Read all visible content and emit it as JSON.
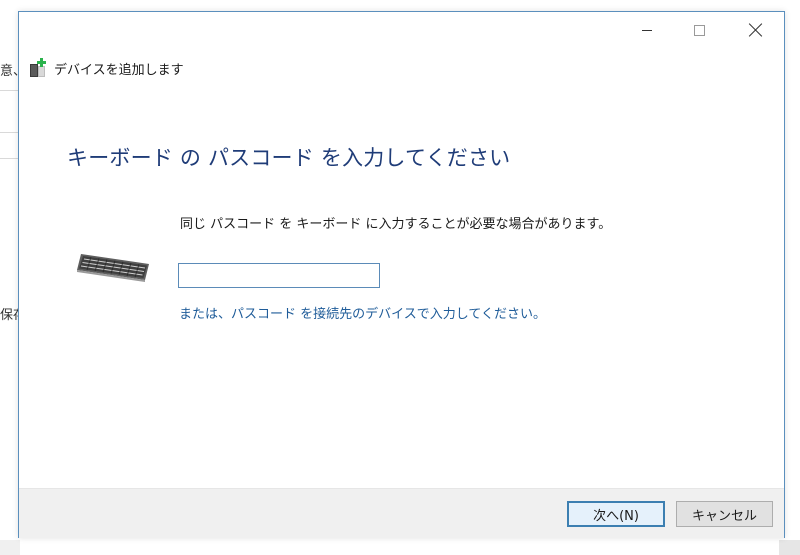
{
  "background_window": {
    "text_top": "意、/",
    "text_mid": "保存"
  },
  "dialog": {
    "title": "デバイスを追加します",
    "heading": "キーボード の パスコード を入力してください",
    "instruction": "同じ パスコード を キーボード に入力することが必要な場合があります。",
    "passcode_value": "",
    "alt_link": "または、パスコード を接続先のデバイスで入力してください。",
    "buttons": {
      "next": "次へ(N)",
      "cancel": "キャンセル"
    }
  },
  "icons": {
    "app": "add-device-icon",
    "keyboard": "keyboard-icon",
    "minimize": "minimize-icon",
    "maximize": "maximize-icon",
    "close": "close-icon"
  },
  "colors": {
    "heading": "#1f3c78",
    "link": "#1f5c99",
    "accent_border": "#3c7fb1",
    "footer_bg": "#f0f0f0"
  }
}
